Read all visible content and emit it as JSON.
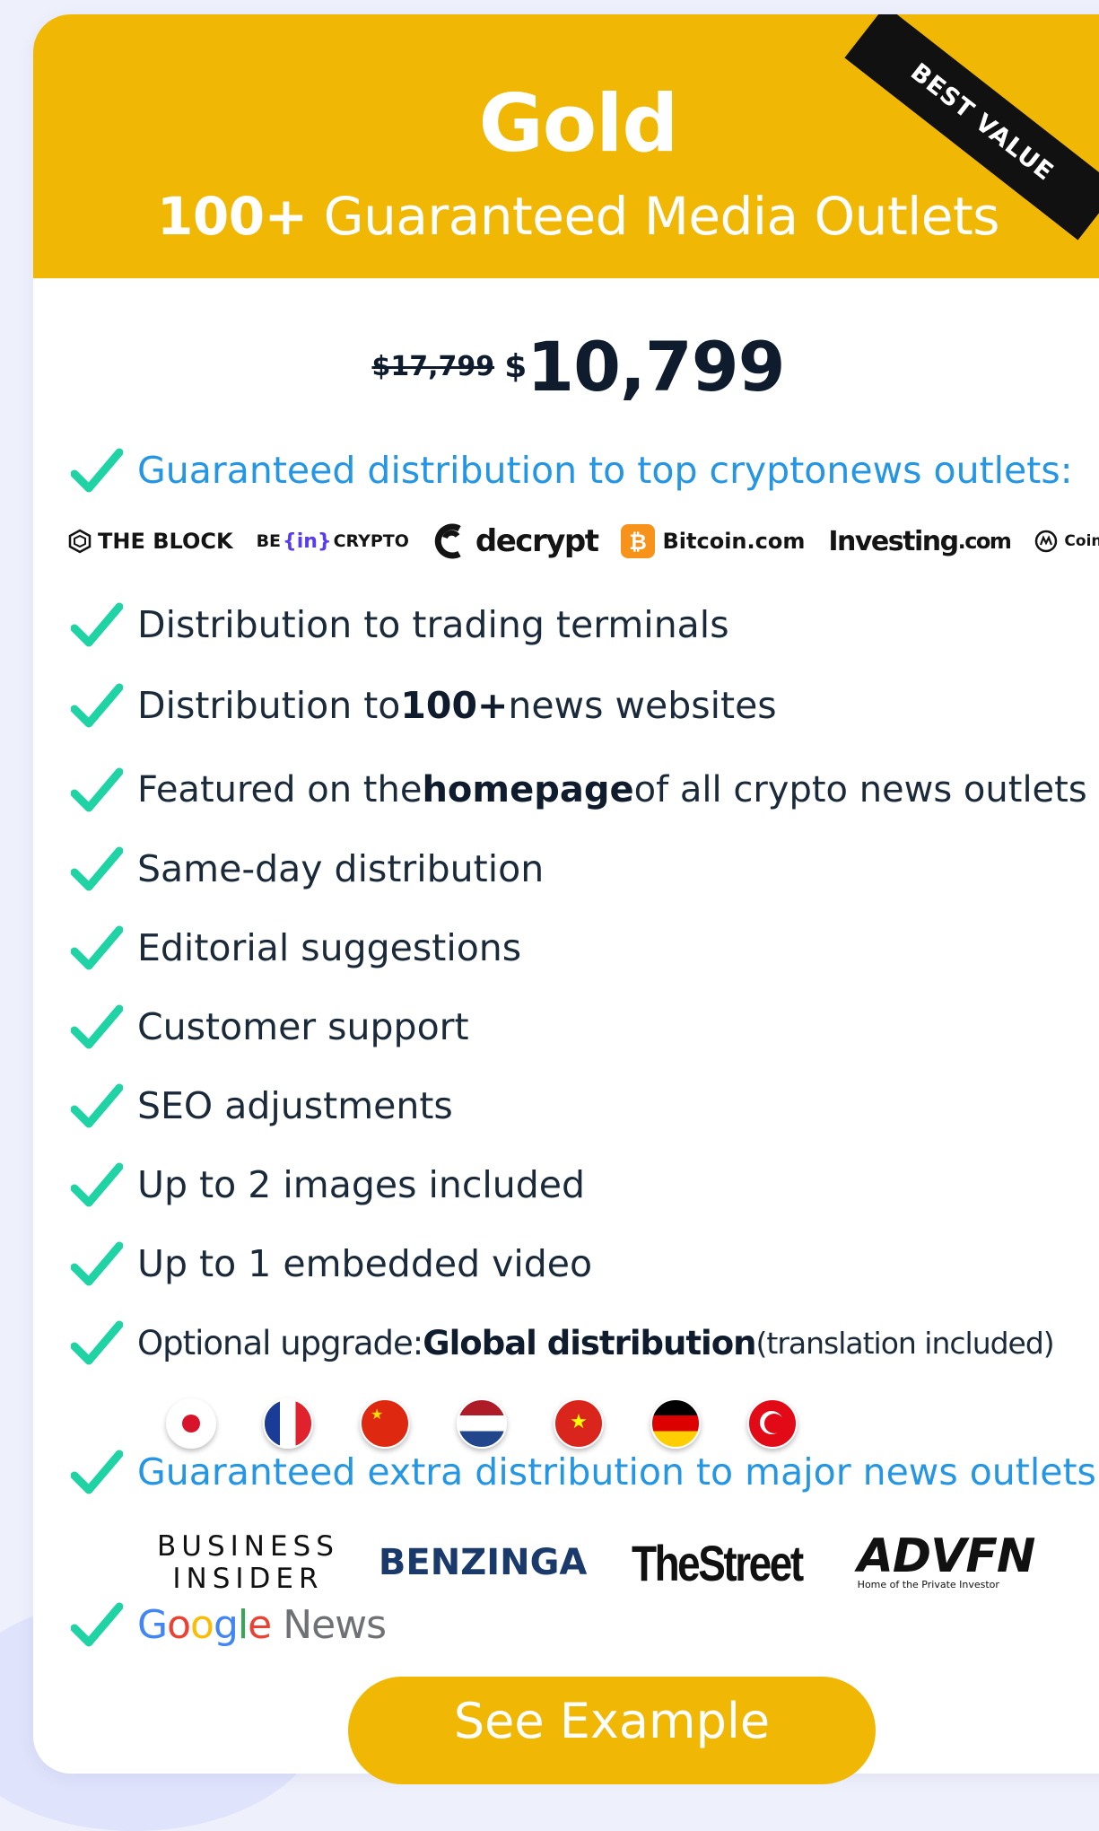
{
  "plan": {
    "name": "Gold",
    "subtitle_bold": "100+",
    "subtitle_rest": " Guaranteed Media Outlets",
    "ribbon": "BEST VALUE",
    "old_price": "$17,799",
    "currency": "$",
    "price": "10,799"
  },
  "colors": {
    "accent": "#f0b705",
    "check": "#1fd3a5",
    "link_blue": "#2596e4",
    "text_dark": "#0f1c2e"
  },
  "features": {
    "f1": "Guaranteed distribution to top cryptonews outlets:",
    "f2": "Distribution to trading terminals",
    "f3_pre": "Distribution to ",
    "f3_bold": "100+",
    "f3_post": " news websites",
    "f4_pre": "Featured on the ",
    "f4_bold": "homepage",
    "f4_post": " of all crypto news outlets",
    "f5": "Same-day distribution",
    "f6": "Editorial suggestions",
    "f7": "Customer support",
    "f8": "SEO adjustments",
    "f9": "Up to 2 images included",
    "f10": "Up to 1 embedded video",
    "f11_pre": "Optional upgrade: ",
    "f11_bold": "Global distribution",
    "f11_post": " (translation included)",
    "f12": "Guaranteed extra distribution to major news outlets:"
  },
  "crypto_logos": {
    "theblock": "THE BLOCK",
    "beincrypto_a": "BE",
    "beincrypto_b": "{in}",
    "beincrypto_c": "CRYPTO",
    "decrypt": "decrypt",
    "bitcoin": "Bitcoin.com",
    "investing_a": "Investing",
    "investing_b": ".com",
    "cmc": "CoinMarketCap"
  },
  "flags": [
    "japan-flag-icon",
    "france-flag-icon",
    "china-flag-icon",
    "netherlands-flag-icon",
    "vietnam-flag-icon",
    "germany-flag-icon",
    "turkey-flag-icon"
  ],
  "major_logos": {
    "bi_line1": "BUSINESS",
    "bi_line2": "INSIDER",
    "benzinga": "BENZINGA",
    "thestreet": "TheStreet",
    "advfn": "ADVFN",
    "advfn_tag": "Home of the Private Investor"
  },
  "google_news": {
    "g": "G",
    "o1": "o",
    "o2": "o",
    "g2": "g",
    "l": "l",
    "e": "e",
    "news": " News"
  },
  "button": {
    "label": "See Example"
  }
}
